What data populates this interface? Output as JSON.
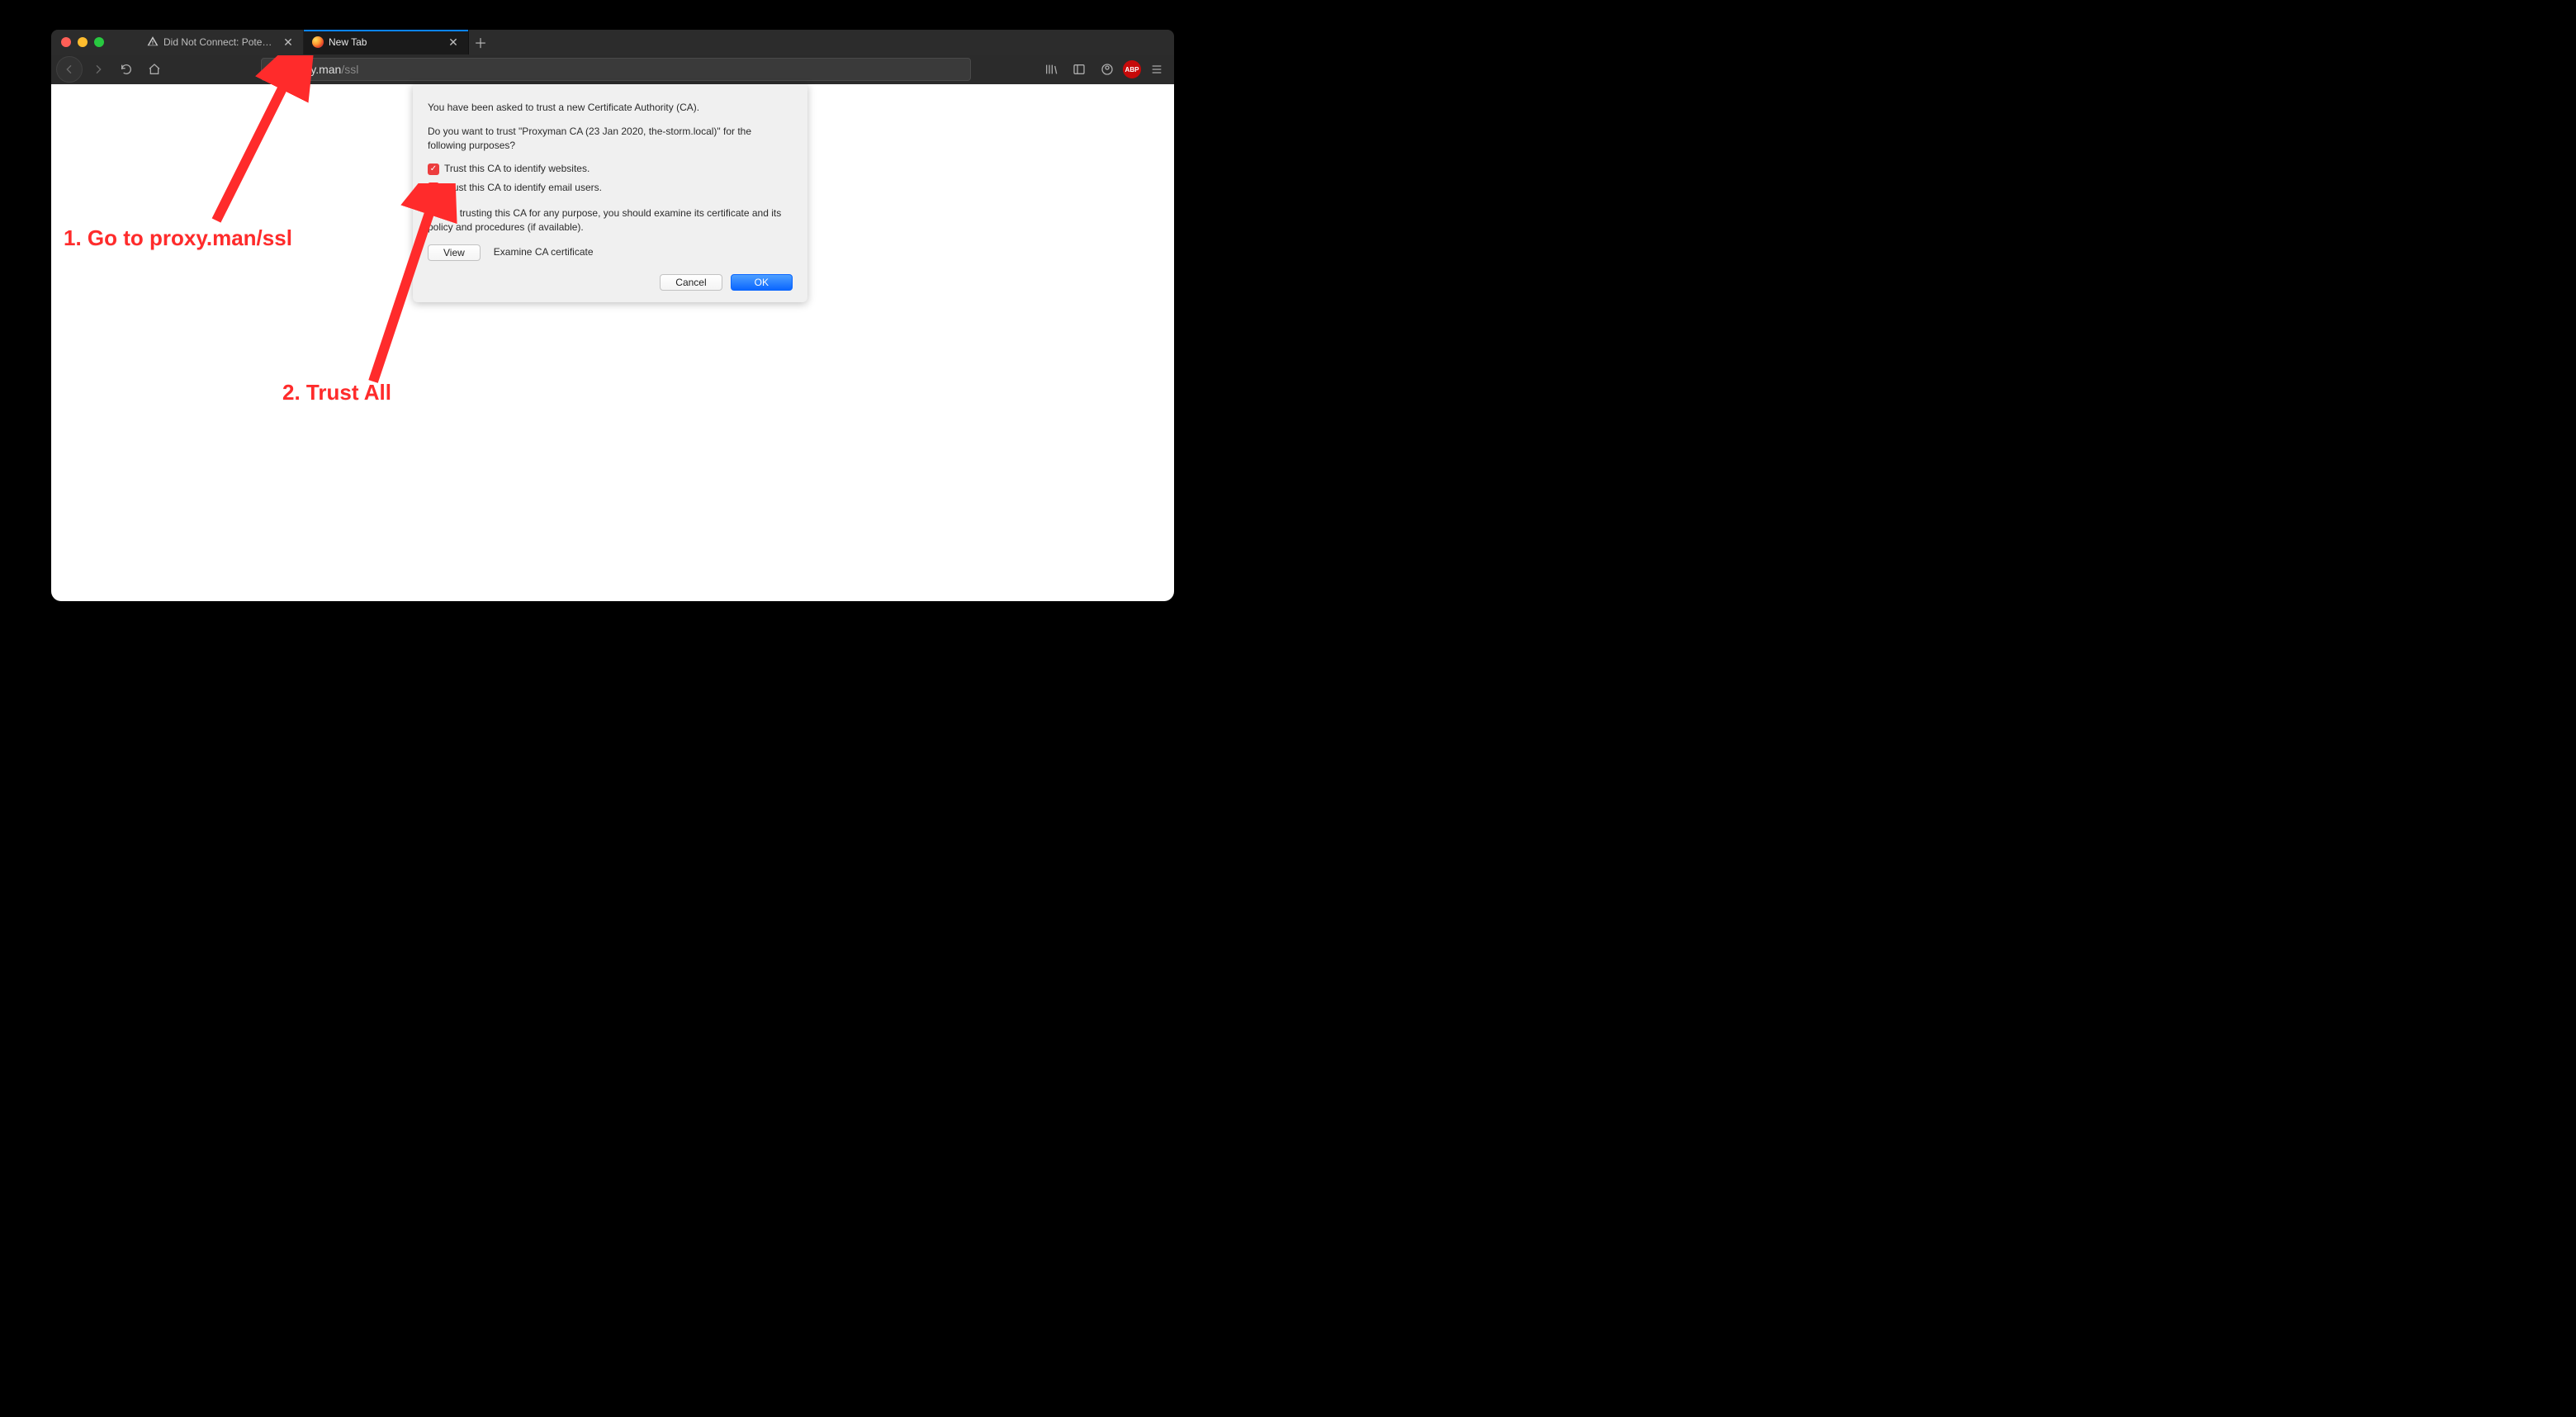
{
  "tabs": [
    {
      "label": "Did Not Connect: Potential Sec",
      "active": false
    },
    {
      "label": "New Tab",
      "active": true
    }
  ],
  "addressbar": {
    "url_main": "proxy.man",
    "url_dim": "/ssl"
  },
  "toolbar_right": {
    "abp_label": "ABP"
  },
  "dialog": {
    "heading": "You have been asked to trust a new Certificate Authority (CA).",
    "question": "Do you want to trust \"Proxyman CA (23 Jan 2020, the-storm.local)\" for the following purposes?",
    "check1_label": "Trust this CA to identify websites.",
    "check2_label": "Trust this CA to identify email users.",
    "warning": "Before trusting this CA for any purpose, you should examine its certificate and its policy and procedures (if available).",
    "view_label": "View",
    "examine_label": "Examine CA certificate",
    "cancel_label": "Cancel",
    "ok_label": "OK"
  },
  "annotations": {
    "step1": "1. Go to proxy.man/ssl",
    "step2": "2. Trust All"
  }
}
